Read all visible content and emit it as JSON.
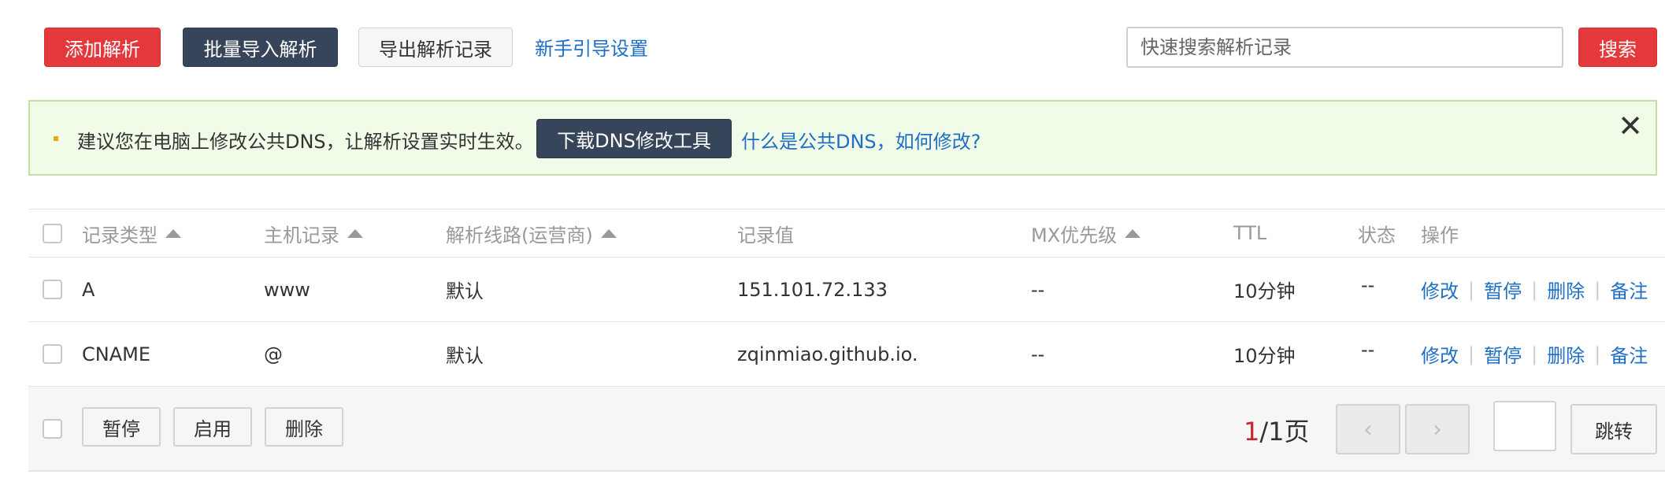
{
  "toolbar": {
    "add_label": "添加解析",
    "import_label": "批量导入解析",
    "export_label": "导出解析记录",
    "guide_link": "新手引导设置",
    "search_placeholder": "快速搜索解析记录",
    "search_label": "搜索"
  },
  "notice": {
    "message": "建议您在电脑上修改公共DNS，让解析设置实时生效。",
    "download_label": "下载DNS修改工具",
    "help_link": "什么是公共DNS，如何修改?",
    "close_icon": "close-icon"
  },
  "table": {
    "headers": {
      "type": "记录类型",
      "host": "主机记录",
      "line": "解析线路(运营商)",
      "value": "记录值",
      "mx": "MX优先级",
      "ttl": "TTL",
      "status": "状态",
      "ops": "操作"
    },
    "rows": [
      {
        "type": "A",
        "host": "www",
        "line": "默认",
        "value": "151.101.72.133",
        "mx": "--",
        "ttl": "10分钟",
        "status": "--"
      },
      {
        "type": "CNAME",
        "host": "@",
        "line": "默认",
        "value": "zqinmiao.github.io.",
        "mx": "--",
        "ttl": "10分钟",
        "status": "--"
      }
    ],
    "actions": {
      "edit": "修改",
      "pause": "暂停",
      "delete": "删除",
      "note": "备注",
      "separator": "|"
    }
  },
  "footer": {
    "pause_label": "暂停",
    "enable_label": "启用",
    "delete_label": "删除",
    "current_page": "1",
    "total_pages": "/1页",
    "prev_icon": "‹",
    "next_icon": "›",
    "jump_label": "跳转"
  },
  "colors": {
    "primary_red": "#e4393c",
    "dark_button": "#37455b",
    "link_blue": "#1e6fc5",
    "notice_bg": "#f1fce8",
    "notice_border": "#bfe3a5"
  }
}
